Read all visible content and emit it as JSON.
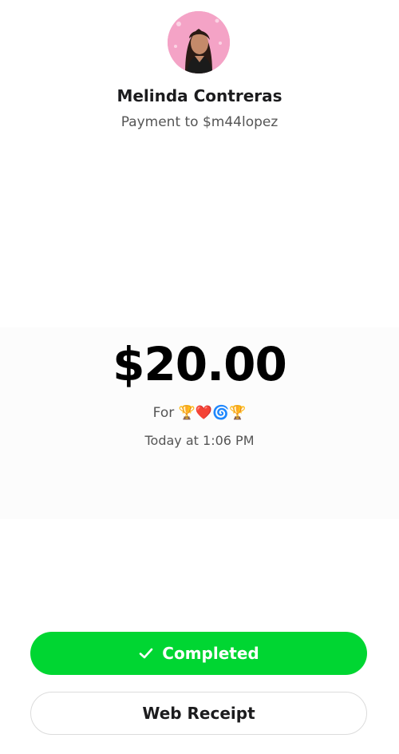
{
  "recipient": {
    "name": "Melinda Contreras",
    "subtitle": "Payment to $m44lopez"
  },
  "payment": {
    "amount": "$20.00",
    "for_label": "For",
    "note_emojis": "🏆❤️🌀🏆",
    "timestamp": "Today at 1:06 PM"
  },
  "actions": {
    "completed_label": "Completed",
    "web_receipt_label": "Web Receipt"
  },
  "colors": {
    "accent_green": "#00d632",
    "avatar_background": "#f3a1c4"
  },
  "icons": {
    "status": "check-icon",
    "avatar": "avatar-photo"
  }
}
